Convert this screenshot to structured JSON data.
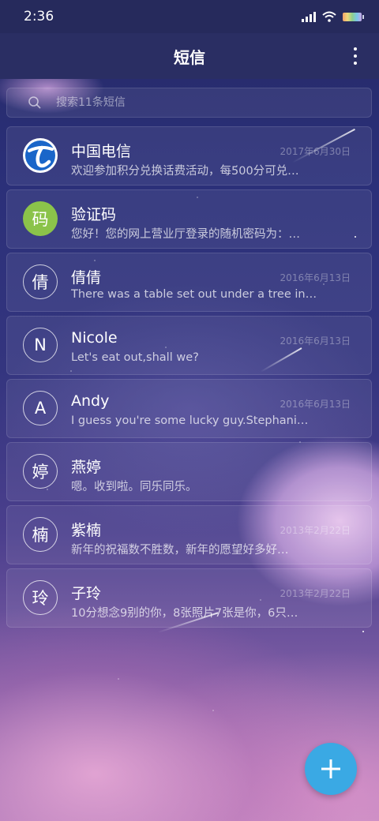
{
  "status_bar": {
    "time": "2:36"
  },
  "header": {
    "title": "短信"
  },
  "search": {
    "placeholder": "搜索11条短信"
  },
  "messages": [
    {
      "name": "中国电信",
      "avatar": "",
      "avatar_style": "telecom",
      "date": "2017年6月30日",
      "preview": "欢迎参加积分兑换话费活动，每500分可兑…"
    },
    {
      "name": "验证码",
      "avatar": "码",
      "avatar_style": "green",
      "date": "",
      "preview": "您好！您的网上营业厅登录的随机密码为：…"
    },
    {
      "name": "倩倩",
      "avatar": "倩",
      "avatar_style": "outline",
      "date": "2016年6月13日",
      "preview": "There was a table set out under a tree in…"
    },
    {
      "name": "Nicole",
      "avatar": "N",
      "avatar_style": "outline",
      "date": "2016年6月13日",
      "preview": "Let's eat out,shall we?"
    },
    {
      "name": "Andy",
      "avatar": "A",
      "avatar_style": "outline",
      "date": "2016年6月13日",
      "preview": "I guess you're some lucky guy.Stephani…"
    },
    {
      "name": "燕婷",
      "avatar": "婷",
      "avatar_style": "outline",
      "date": "",
      "preview": "嗯。收到啦。同乐同乐。"
    },
    {
      "name": "紫楠",
      "avatar": "楠",
      "avatar_style": "outline",
      "date": "2013年2月22日",
      "preview": "新年的祝福数不胜数，新年的愿望好多好…"
    },
    {
      "name": "子玲",
      "avatar": "玲",
      "avatar_style": "outline",
      "date": "2013年2月22日",
      "preview": "10分想念9别的你，8张照片7张是你，6只…"
    }
  ],
  "icons": {
    "more": "more-vertical-icon",
    "search": "search-icon",
    "fab": "plus-icon"
  },
  "colors": {
    "fab": "#3aa9e4",
    "verify_avatar": "#8bc34a",
    "telecom_blue": "#1a66c9"
  }
}
